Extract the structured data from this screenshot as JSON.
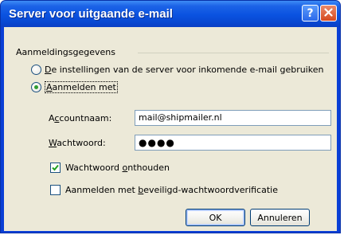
{
  "dialog": {
    "title": "Server voor uitgaande e-mail",
    "help_label": "?",
    "close_label": "✕"
  },
  "group": {
    "label": "Aanmeldingsgegevens"
  },
  "options": {
    "use_incoming": {
      "accel": "D",
      "rest": "e instellingen van de server voor inkomende e-mail gebruiken",
      "selected": false
    },
    "login_with": {
      "accel": "A",
      "rest": "anmelden met",
      "selected": true
    }
  },
  "fields": {
    "account": {
      "label_pre": "A",
      "label_accel": "c",
      "label_post": "countnaam:",
      "value": "mail@shipmailer.nl"
    },
    "password": {
      "label_accel": "W",
      "label_post": "achtwoord:",
      "value": "●●●●"
    }
  },
  "checks": {
    "remember": {
      "pre": "Wachtwoord ",
      "accel": "o",
      "post": "nthouden",
      "checked": true
    },
    "spa": {
      "pre": "Aanmelden met ",
      "accel": "b",
      "post": "eveiligd-wachtwoordverificatie",
      "checked": false
    }
  },
  "buttons": {
    "ok": "OK",
    "cancel": "Annuleren"
  }
}
